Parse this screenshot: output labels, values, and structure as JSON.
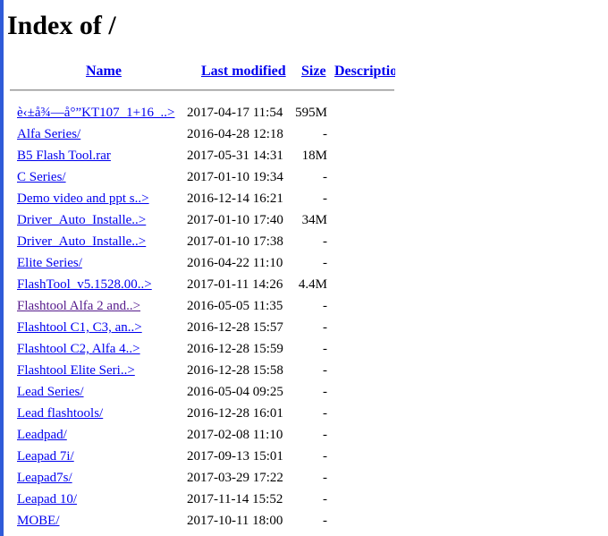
{
  "title": "Index of /",
  "headers": {
    "name": "Name",
    "last_modified": "Last modified",
    "size": "Size",
    "description": "Description"
  },
  "entries": [
    {
      "name": "è‹±å¾—å°”KT107_1+16_..>",
      "modified": "2017-04-17 11:54",
      "size": "595M",
      "visited": false
    },
    {
      "name": "Alfa Series/",
      "modified": "2016-04-28 12:18",
      "size": "-",
      "visited": false
    },
    {
      "name": "B5 Flash Tool.rar",
      "modified": "2017-05-31 14:31",
      "size": "18M",
      "visited": false
    },
    {
      "name": "C Series/",
      "modified": "2017-01-10 19:34",
      "size": "-",
      "visited": false
    },
    {
      "name": "Demo video and ppt s..>",
      "modified": "2016-12-14 16:21",
      "size": "-",
      "visited": false
    },
    {
      "name": "Driver_Auto_Installe..>",
      "modified": "2017-01-10 17:40",
      "size": "34M",
      "visited": false
    },
    {
      "name": "Driver_Auto_Installe..>",
      "modified": "2017-01-10 17:38",
      "size": "-",
      "visited": false
    },
    {
      "name": "Elite Series/",
      "modified": "2016-04-22 11:10",
      "size": "-",
      "visited": false
    },
    {
      "name": "FlashTool_v5.1528.00..>",
      "modified": "2017-01-11 14:26",
      "size": "4.4M",
      "visited": false
    },
    {
      "name": "Flashtool Alfa 2 and..>",
      "modified": "2016-05-05 11:35",
      "size": "-",
      "visited": true
    },
    {
      "name": "Flashtool C1, C3, an..>",
      "modified": "2016-12-28 15:57",
      "size": "-",
      "visited": false
    },
    {
      "name": "Flashtool C2, Alfa 4..>",
      "modified": "2016-12-28 15:59",
      "size": "-",
      "visited": false
    },
    {
      "name": "Flashtool Elite Seri..>",
      "modified": "2016-12-28 15:58",
      "size": "-",
      "visited": false
    },
    {
      "name": "Lead Series/",
      "modified": "2016-05-04 09:25",
      "size": "-",
      "visited": false
    },
    {
      "name": "Lead flashtools/",
      "modified": "2016-12-28 16:01",
      "size": "-",
      "visited": false
    },
    {
      "name": "Leadpad/",
      "modified": "2017-02-08 11:10",
      "size": "-",
      "visited": false
    },
    {
      "name": "Leapad 7i/",
      "modified": "2017-09-13 15:01",
      "size": "-",
      "visited": false
    },
    {
      "name": "Leapad7s/",
      "modified": "2017-03-29 17:22",
      "size": "-",
      "visited": false
    },
    {
      "name": "Leapad 10/",
      "modified": "2017-11-14 15:52",
      "size": "-",
      "visited": false
    },
    {
      "name": "MOBE/",
      "modified": "2017-10-11 18:00",
      "size": "-",
      "visited": false
    }
  ],
  "colors": {
    "link": "#0000ee",
    "visited_link": "#551a8b",
    "left_border": "#2f5bd8"
  }
}
